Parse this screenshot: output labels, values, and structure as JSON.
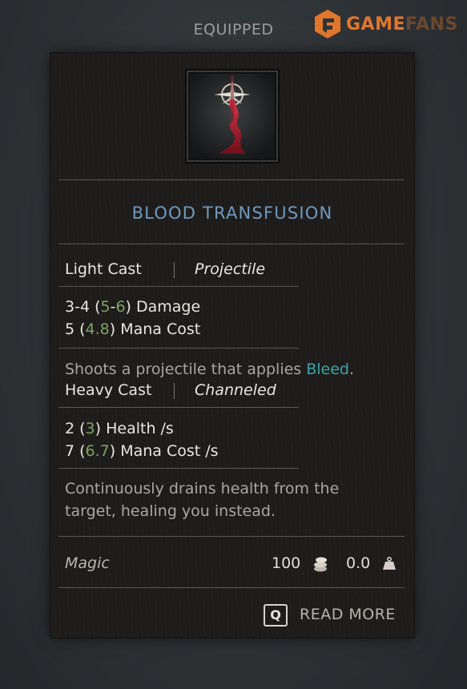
{
  "header": {
    "equipped_label": "EQUIPPED"
  },
  "watermark": {
    "brand_main": "GAME",
    "brand_faded": "FANS"
  },
  "item": {
    "icon": "blood-transfusion-spell-icon",
    "name": "BLOOD TRANSFUSION",
    "light_cast": {
      "label": "Light Cast",
      "type": "Projectile",
      "damage": {
        "base": "3-4",
        "upgraded_min": "5",
        "upgraded_max": "6",
        "suffix": "Damage"
      },
      "mana": {
        "base": "5",
        "upgraded": "4.8",
        "suffix": "Mana Cost"
      },
      "description_prefix": "Shoots a projectile that applies ",
      "description_keyword": "Bleed",
      "description_suffix": "."
    },
    "heavy_cast": {
      "label": "Heavy Cast",
      "type": "Channeled",
      "health": {
        "base": "2",
        "upgraded": "3",
        "suffix": "Health /s"
      },
      "mana": {
        "base": "7",
        "upgraded": "6.7",
        "suffix": "Mana Cost /s"
      },
      "description_line1": "Continuously drains health from the",
      "description_line2": "target, healing you instead."
    },
    "footer": {
      "category": "Magic",
      "value": "100",
      "weight": "0.0"
    }
  },
  "actions": {
    "read_more_key": "Q",
    "read_more_label": "READ MORE"
  },
  "colors": {
    "title": "#6f99c0",
    "upgrade_green": "#7ca462",
    "keyword_teal": "#3fa3a8",
    "brand_orange": "#e0772d"
  }
}
